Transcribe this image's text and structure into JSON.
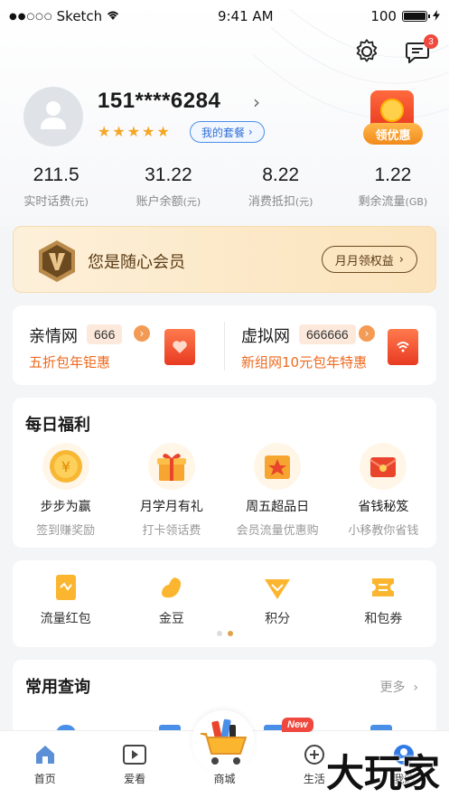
{
  "status_bar": {
    "carrier": "Sketch",
    "time": "9:41 AM",
    "battery": "100"
  },
  "header": {
    "message_badge": "3"
  },
  "profile": {
    "phone": "151****6284",
    "plan_button": "我的套餐",
    "coupon_label": "领优惠"
  },
  "stats": [
    {
      "value": "211.5",
      "label": "实时话费",
      "unit": "(元)"
    },
    {
      "value": "31.22",
      "label": "账户余额",
      "unit": "(元)"
    },
    {
      "value": "8.22",
      "label": "消费抵扣",
      "unit": "(元)"
    },
    {
      "value": "1.22",
      "label": "剩余流量",
      "unit": "(GB)"
    }
  ],
  "member": {
    "title": "您是随心会员",
    "button": "月月领权益"
  },
  "family": [
    {
      "name": "亲情网",
      "number": "666",
      "promo": "五折包年钜惠"
    },
    {
      "name": "虚拟网",
      "number": "666666",
      "promo": "新组网10元包年特惠"
    }
  ],
  "welfare": {
    "title": "每日福利",
    "items": [
      {
        "title": "步步为赢",
        "sub": "签到赚奖励",
        "icon": "coin-icon"
      },
      {
        "title": "月学月有礼",
        "sub": "打卡领话费",
        "icon": "gift-icon"
      },
      {
        "title": "周五超品日",
        "sub": "会员流量优惠购",
        "icon": "star-box-icon"
      },
      {
        "title": "省钱秘笈",
        "sub": "小移教你省钱",
        "icon": "red-envelope-icon"
      }
    ]
  },
  "quick": [
    {
      "label": "流量红包",
      "icon": "data-packet-icon"
    },
    {
      "label": "金豆",
      "icon": "gold-bean-icon"
    },
    {
      "label": "积分",
      "icon": "points-icon"
    },
    {
      "label": "和包券",
      "icon": "voucher-icon"
    }
  ],
  "query": {
    "title": "常用查询",
    "more": "更多"
  },
  "new_tag": "New",
  "tabs": [
    {
      "label": "首页",
      "icon": "home-icon"
    },
    {
      "label": "爱看",
      "icon": "video-icon"
    },
    {
      "label": "商城",
      "icon": "mall-cart-icon"
    },
    {
      "label": "生活",
      "icon": "life-icon"
    },
    {
      "label": "我的",
      "icon": "profile-icon"
    }
  ],
  "watermark": "大玩家",
  "colors": {
    "accent_orange": "#ee6a1f",
    "brand_blue": "#2f6fd6",
    "gold": "#f5a623",
    "badge_red": "#f0483e"
  }
}
